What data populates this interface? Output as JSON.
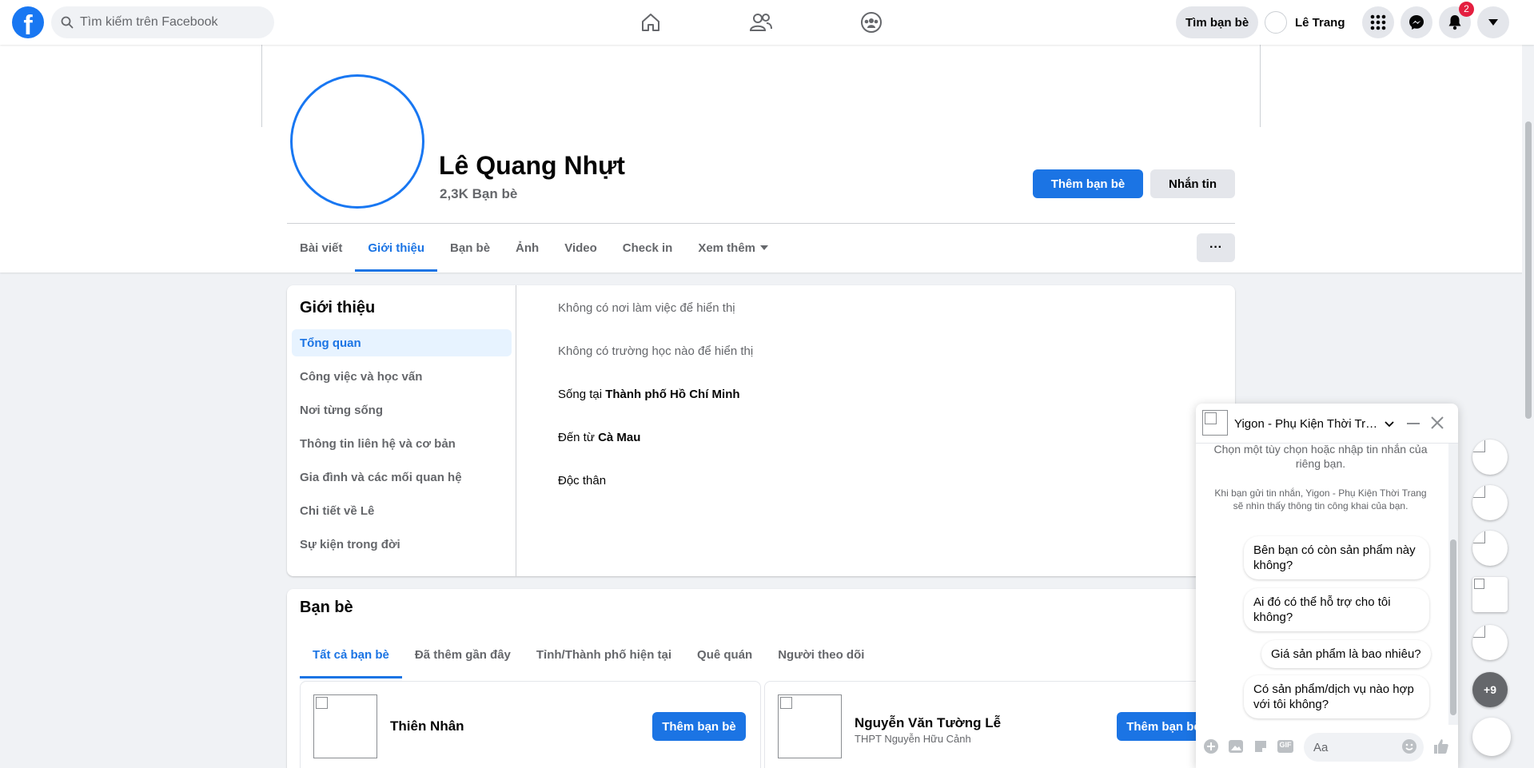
{
  "topbar": {
    "logo": "f",
    "search_placeholder": "Tìm kiếm trên Facebook",
    "find_friends_label": "Tìm bạn bè",
    "user_name": "Lê Trang",
    "notification_count": "2"
  },
  "profile": {
    "name": "Lê Quang Nhựt",
    "friends_count": "2,3K Bạn bè",
    "add_friend_label": "Thêm bạn bè",
    "message_label": "Nhắn tin",
    "more_label": "···"
  },
  "tabs": [
    "Bài viết",
    "Giới thiệu",
    "Bạn bè",
    "Ảnh",
    "Video",
    "Check in",
    "Xem thêm"
  ],
  "intro": {
    "title": "Giới thiệu",
    "menu": [
      "Tổng quan",
      "Công việc và học vấn",
      "Nơi từng sống",
      "Thông tin liên hệ và cơ bản",
      "Gia đình và các mối quan hệ",
      "Chi tiết về Lê",
      "Sự kiện trong đời"
    ],
    "workplace": "Không có nơi làm việc để hiển thị",
    "school": "Không có trường học nào để hiển thị",
    "lives_prefix": "Sống tại",
    "lives_place": "Thành phố Hồ Chí Minh",
    "from_prefix": "Đến từ",
    "from_place": "Cà Mau",
    "relationship": "Độc thân"
  },
  "friends": {
    "title": "Bạn bè",
    "tabs": [
      "Tất cả bạn bè",
      "Đã thêm gần đây",
      "Tỉnh/Thành phố hiện tại",
      "Quê quán",
      "Người theo dõi"
    ],
    "items": [
      {
        "name": "Thiên Nhân",
        "sub": "",
        "button": "Thêm bạn bè"
      },
      {
        "name": "Nguyễn Văn Tường Lễ",
        "sub": "THPT Nguyễn Hữu Cảnh",
        "button": "Thêm bạn bè"
      }
    ]
  },
  "chat": {
    "name": "Yigon - Phụ Kiện Thời Trang",
    "intro_text": "Chọn một tùy chọn hoặc nhập tin nhắn của riêng bạn.",
    "privacy_note": "Khi bạn gửi tin nhắn, Yigon - Phụ Kiện Thời Trang sẽ nhìn thấy thông tin công khai của bạn.",
    "quick_replies": [
      "Bên bạn có còn sản phẩm này không?",
      "Ai đó có thể hỗ trợ cho tôi không?",
      "Giá sản phẩm là bao nhiêu?",
      "Có sản phẩm/dịch vụ nào hợp với tôi không?"
    ],
    "input_placeholder": "Aa",
    "gif_label": "GIF"
  },
  "rail": {
    "more_count": "+9"
  },
  "colors": {
    "primary": "#1b74e4",
    "facebook_blue": "#1877f2",
    "badge_red": "#e41e3f",
    "page_bg": "#f0f2f5"
  }
}
